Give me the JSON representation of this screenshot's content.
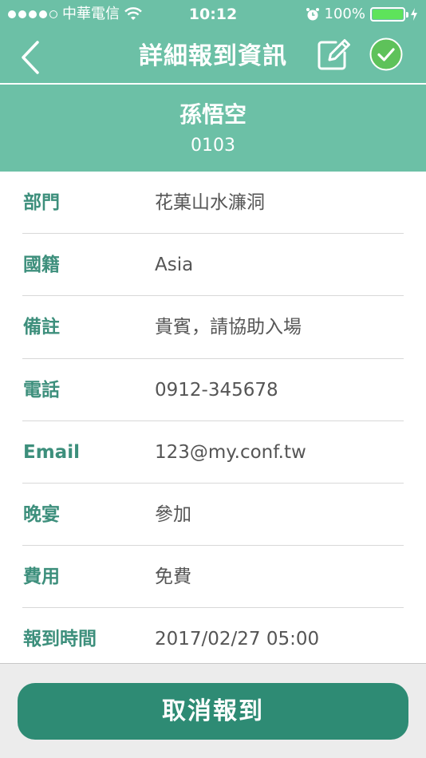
{
  "status_bar": {
    "carrier": "中華電信",
    "time": "10:12",
    "battery": "100%",
    "battery_level": 1.0,
    "icons": [
      "signal-icon",
      "wifi-icon",
      "alarm-icon",
      "battery-icon",
      "charging-bolt-icon"
    ]
  },
  "nav": {
    "title": "詳細報到資訊",
    "back_icon": "chevron-left-icon",
    "edit_icon": "edit-icon",
    "confirm_icon": "check-circle-icon"
  },
  "header": {
    "name": "孫悟空",
    "id": "0103"
  },
  "details": [
    {
      "label": "部門",
      "value": "花菓山水濂洞"
    },
    {
      "label": "國籍",
      "value": "Asia"
    },
    {
      "label": "備註",
      "value": "貴賓，請協助入場"
    },
    {
      "label": "電話",
      "value": "0912-345678"
    },
    {
      "label": "Email",
      "value": "123@my.conf.tw"
    },
    {
      "label": "晚宴",
      "value": "參加"
    },
    {
      "label": "費用",
      "value": "免費"
    },
    {
      "label": "報到時間",
      "value": "2017/02/27 05:00"
    }
  ],
  "actions": {
    "cancel_label": "取消報到"
  },
  "colors": {
    "primary": "#6cc0a6",
    "label": "#3d8f7c",
    "button": "#2e8b74",
    "confirm": "#5ec25a"
  }
}
